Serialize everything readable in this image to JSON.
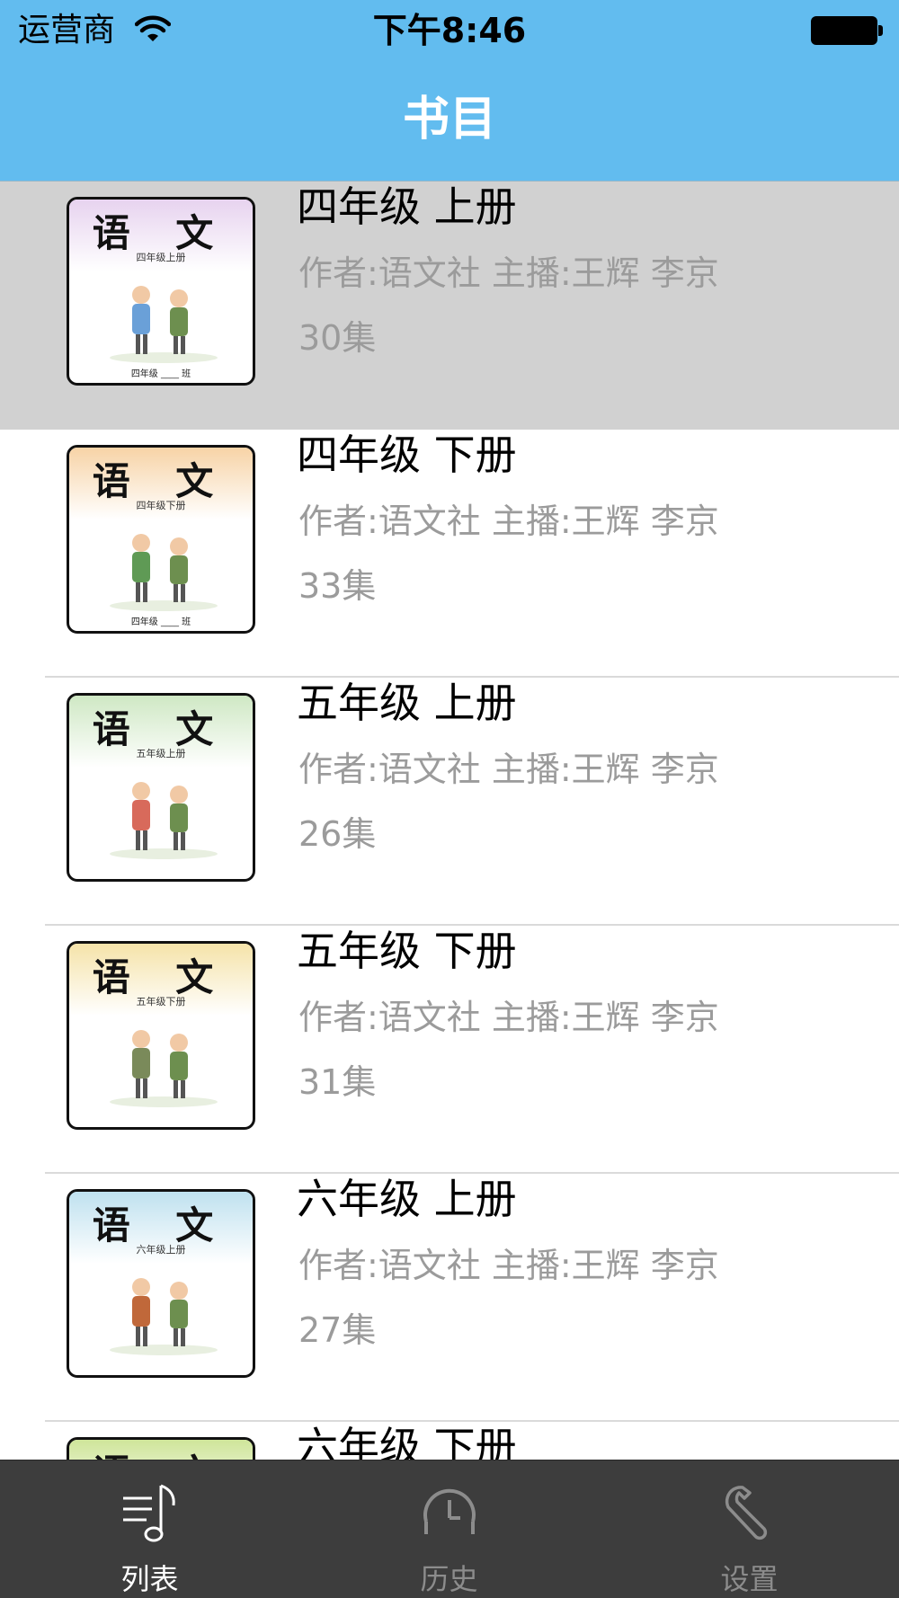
{
  "status_bar": {
    "carrier": "运营商",
    "time": "下午8:46"
  },
  "nav": {
    "title": "书目"
  },
  "books": [
    {
      "title": "四年级 上册",
      "meta": "作者:语文社  主播:王辉 李京",
      "count": "30集",
      "selected": true,
      "cover": {
        "title": "语 文",
        "subtitle": "四年级上册",
        "footer": "四年级 ____ 班",
        "band_color": "#e7d3ef"
      }
    },
    {
      "title": "四年级 下册",
      "meta": "作者:语文社  主播:王辉 李京",
      "count": "33集",
      "cover": {
        "title": "语 文",
        "subtitle": "四年级下册",
        "footer": "四年级 ____ 班",
        "band_color": "#f7d3a6"
      }
    },
    {
      "title": "五年级 上册",
      "meta": "作者:语文社  主播:王辉 李京",
      "count": "26集",
      "cover": {
        "title": "语 文",
        "subtitle": "五年级上册",
        "footer": "",
        "band_color": "#cfe8c4"
      }
    },
    {
      "title": "五年级 下册",
      "meta": "作者:语文社  主播:王辉 李京",
      "count": "31集",
      "cover": {
        "title": "语 文",
        "subtitle": "五年级下册",
        "footer": "",
        "band_color": "#f5e3a9"
      }
    },
    {
      "title": "六年级 上册",
      "meta": "作者:语文社  主播:王辉 李京",
      "count": "27集",
      "cover": {
        "title": "语 文",
        "subtitle": "六年级上册",
        "footer": "",
        "band_color": "#bfe1ef"
      }
    },
    {
      "title": "六年级 下册",
      "meta": "作者:语文社  主播:王辉 李京",
      "count": "",
      "cover": {
        "title": "语 文",
        "subtitle": "",
        "footer": "",
        "band_color": "#cfe59a"
      }
    }
  ],
  "tabs": [
    {
      "label": "列表",
      "icon": "music-list-icon",
      "active": true
    },
    {
      "label": "历史",
      "icon": "clock-icon",
      "active": false
    },
    {
      "label": "设置",
      "icon": "wrench-icon",
      "active": false
    }
  ],
  "colors": {
    "nav_bg": "#62bcef",
    "selected_row_bg": "#d1d1d1",
    "tabbar_bg": "#3d3d3d",
    "meta_text": "#9b9b9b"
  }
}
